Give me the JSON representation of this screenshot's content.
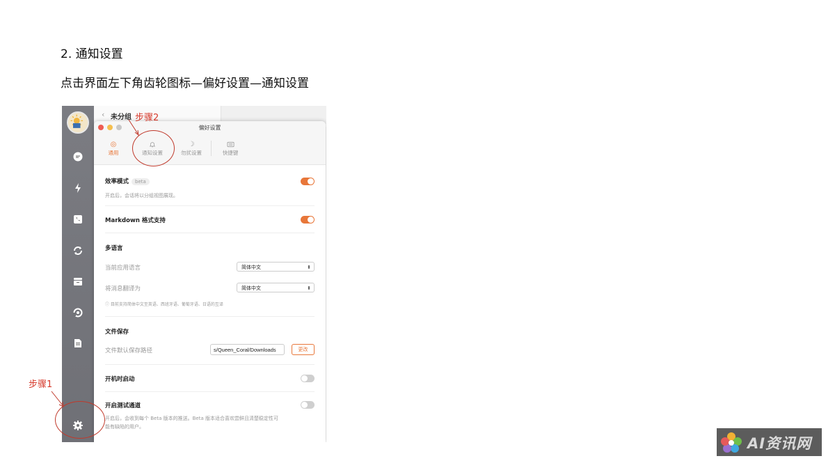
{
  "headings": {
    "section": "2. 通知设置",
    "instruction": "点击界面左下角齿轮图标—偏好设置—通知设置"
  },
  "annotations": {
    "step1": "步骤1",
    "step2": "步骤2",
    "color": "#d63a2c"
  },
  "app": {
    "group_title": "未分组",
    "window_title": "偏好设置",
    "accent": "#e8773a",
    "traffic_lights": [
      "#ee5c52",
      "#f5bf4f",
      "#c8c8c8"
    ],
    "sidebar_icons": [
      "chat-icon",
      "lightning-icon",
      "phone-icon",
      "loop-icon",
      "folder-icon",
      "swirl-icon",
      "document-icon",
      "gear-icon"
    ],
    "tabs": [
      {
        "label": "通用",
        "icon": "target-icon",
        "active": true
      },
      {
        "label": "通知设置",
        "icon": "bell-icon",
        "active": false
      },
      {
        "label": "勿扰设置",
        "icon": "moon-icon",
        "active": false
      },
      {
        "label": "快捷键",
        "icon": "keyboard-icon",
        "active": false
      }
    ],
    "settings": {
      "efficiency": {
        "title": "效率模式",
        "badge": "beta",
        "desc": "开启后，会话将以分组视图展现。",
        "enabled": true
      },
      "markdown": {
        "title": "Markdown 格式支持",
        "enabled": true
      },
      "language": {
        "title": "多语言",
        "current_label": "当前应用语言",
        "current_value": "简体中文",
        "translate_label": "将消息翻译为",
        "translate_value": "简体中文",
        "note": "目前支持简体中文至英语、西班牙语、葡萄牙语、日语的互译"
      },
      "file": {
        "title": "文件保存",
        "path_label": "文件默认保存路径",
        "path_value": "s/Queen_Coral/Downloads",
        "change_label": "更改"
      },
      "startup": {
        "title": "开机时启动",
        "enabled": false
      },
      "beta_channel": {
        "title": "开启测试通道",
        "desc_line1": "开启后，会收到每个 Beta 版本的推送。Beta 版本适合喜欢尝鲜且清楚稳定性可",
        "desc_line2": "能有缺陷的用户。",
        "enabled": false
      }
    }
  },
  "watermark": {
    "text": "AI资讯网"
  }
}
